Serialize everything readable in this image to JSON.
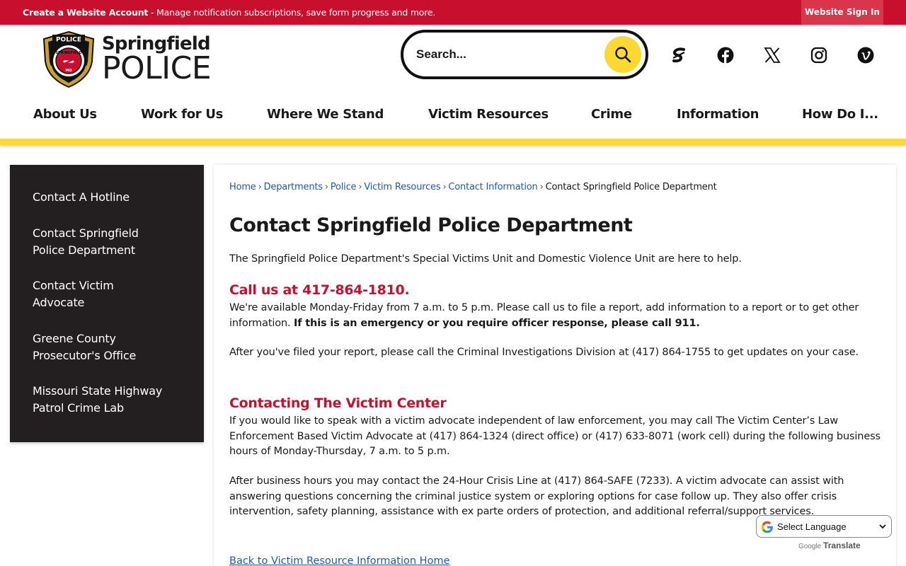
{
  "topbar": {
    "create_account": "Create a Website Account",
    "message": " - Manage notification subscriptions, save form progress and more.",
    "sign_in": "Website Sign In"
  },
  "logo": {
    "word1": "Springfield",
    "word2": "POLICE",
    "badge_top": "POLICE",
    "badge_ring": "SPRINGFIELD",
    "badge_bottom": "MO"
  },
  "search": {
    "placeholder": "Search..."
  },
  "social": [
    "springfield-s-icon",
    "facebook-icon",
    "x-icon",
    "instagram-icon",
    "vimeo-icon"
  ],
  "nav": [
    "About Us",
    "Work for Us",
    "Where We Stand",
    "Victim Resources",
    "Crime",
    "Information",
    "How Do I..."
  ],
  "sidebar": {
    "items": [
      "Contact A Hotline",
      "Contact Springfield Police Department",
      "Contact Victim Advocate",
      "Greene County Prosecutor's Office",
      "Missouri State Highway Patrol Crime Lab"
    ]
  },
  "breadcrumb": [
    "Home",
    "Departments",
    "Police",
    "Victim Resources",
    "Contact Information",
    "Contact Springfield Police Department"
  ],
  "main": {
    "title": "Contact Springfield Police Department",
    "intro": "The Springfield Police Department's Special Victims Unit and Domestic Violence Unit are here to help.",
    "call_heading": "Call us at 417-864-1810.",
    "call_text": "We're available Monday-Friday from 7 a.m. to 5 p.m. Please call us to file a report, add information to a report or to get other information. ",
    "call_bold": "If this is an emergency or you require officer response, please call 911.",
    "after_report": "After you've filed your report, please call the Criminal Investigations Division at (417) 864-1755 to get updates on your case.",
    "victim_heading": "Contacting The Victim Center",
    "victim_text": "If you would like to speak with a victim advocate independent of law enforcement,  you may call The Victim Center’s Law Enforcement Based Victim Advocate at (417) 864-1324 (direct office) or (417) 633-8071 (work cell) during the following business hours of Monday-Thursday, 7 a.m. to 5 p.m.",
    "after_hours": "After business hours you may contact the 24-Hour Crisis Line at (417) 864-SAFE (7233).  A victim advocate can assist with answering questions concerning the criminal justice system or exploring options for case follow up.  They also offer crisis intervention, safety planning, assistance with ex parte orders of protection, and additional referral/support services.",
    "back_link": "Back to Victim Resource Information Home"
  },
  "translate": {
    "select_label": "Select Language",
    "powered_google": "Google",
    "powered_translate": "Translate"
  },
  "colors": {
    "brand_red": "#c8102e",
    "accent_yellow": "#fbd930",
    "sidebar_bg": "#231f20",
    "link_blue": "#1e5aa8"
  }
}
